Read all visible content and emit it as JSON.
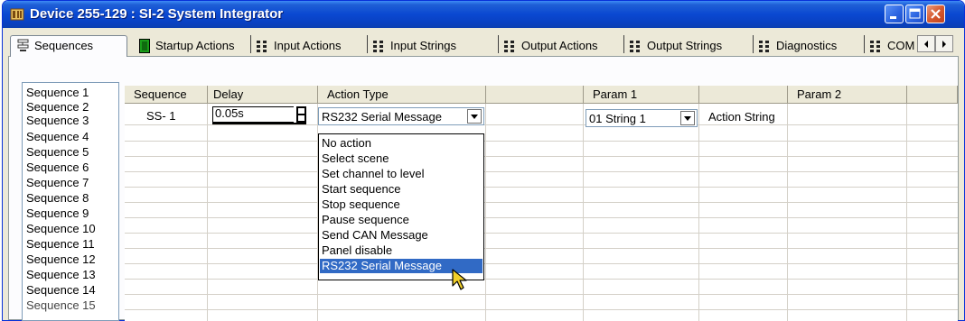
{
  "window": {
    "title": "Device 255-129 : SI-2 System Integrator",
    "app_icon": "device-app-icon"
  },
  "title_buttons": [
    {
      "icon": "minimize-icon"
    },
    {
      "icon": "maximize-icon"
    },
    {
      "icon": "close-icon"
    }
  ],
  "tabs": [
    {
      "label": "Sequences",
      "icon": "sequences-icon",
      "active": true
    },
    {
      "label": "Startup Actions",
      "icon": "startup-icon"
    },
    {
      "label": "Input Actions",
      "icon": "dots-icon"
    },
    {
      "label": "Input Strings",
      "icon": "dots-icon"
    },
    {
      "label": "Output Actions",
      "icon": "dots-icon"
    },
    {
      "label": "Output Strings",
      "icon": "dots-icon"
    },
    {
      "label": "Diagnostics",
      "icon": "dots-icon"
    },
    {
      "label": "COM",
      "icon": "dots-icon"
    }
  ],
  "sequences": [
    "Sequence 1",
    "Sequence 2",
    "Sequence 3",
    "Sequence 4",
    "Sequence 5",
    "Sequence 6",
    "Sequence 7",
    "Sequence 8",
    "Sequence 9",
    "Sequence 10",
    "Sequence 11",
    "Sequence 12",
    "Sequence 13",
    "Sequence 14",
    "Sequence 15"
  ],
  "grid": {
    "headers": [
      "Sequence",
      "Delay",
      "Action Type",
      "",
      "Param 1",
      "",
      "Param 2",
      ""
    ],
    "row1": {
      "sequence": "SS- 1",
      "delay": "0.05s",
      "action_type": "RS232 Serial Message",
      "param1": "01 String 1",
      "param1_label": "Action String"
    }
  },
  "dropdown": {
    "options": [
      "No action",
      "Select scene",
      "Set channel to level",
      "Start sequence",
      "Stop sequence",
      "Pause sequence",
      "Send CAN Message",
      "Panel disable",
      "RS232 Serial Message"
    ],
    "selected": "RS232 Serial Message"
  },
  "colors": {
    "title_bar": "#0a48d1",
    "selection": "#316ac5",
    "tab_active_icon": "#1a9e1a"
  }
}
